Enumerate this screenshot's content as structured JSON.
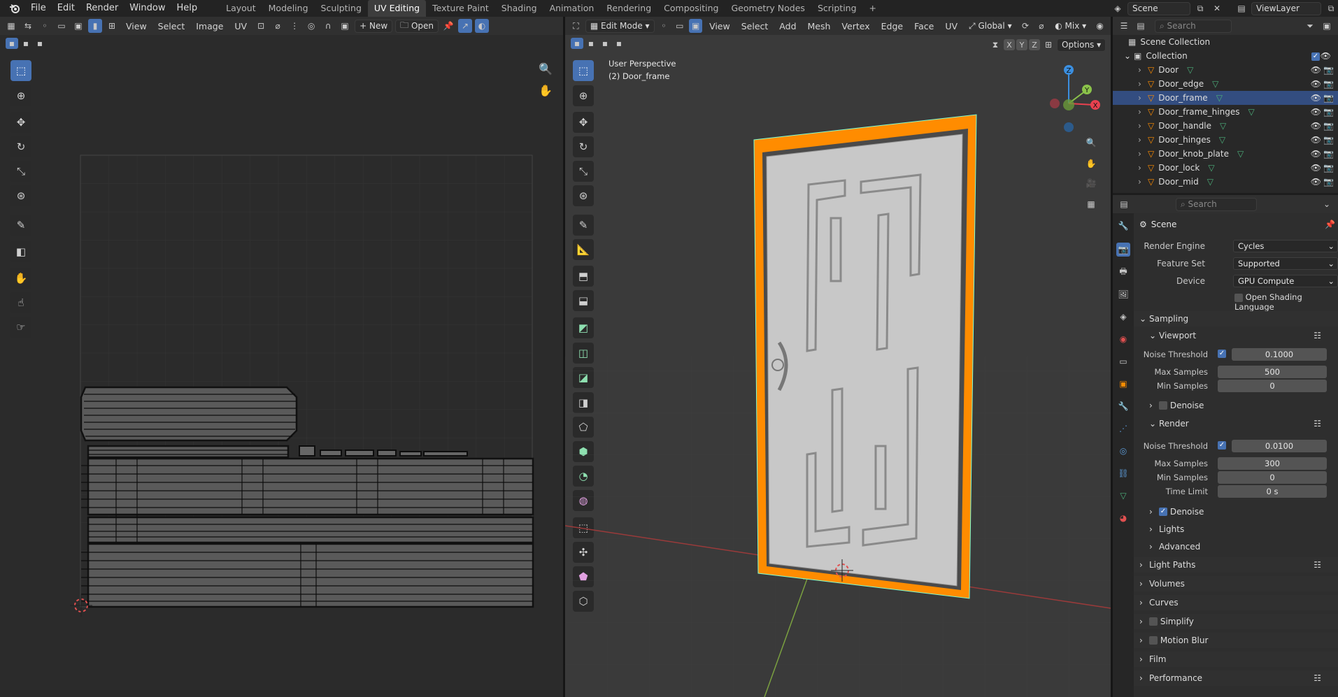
{
  "topbar": {
    "menus": [
      "File",
      "Edit",
      "Render",
      "Window",
      "Help"
    ],
    "workspaces": [
      "Layout",
      "Modeling",
      "Sculpting",
      "UV Editing",
      "Texture Paint",
      "Shading",
      "Animation",
      "Rendering",
      "Compositing",
      "Geometry Nodes",
      "Scripting"
    ],
    "active_workspace": "UV Editing",
    "scene": "Scene",
    "view_layer": "ViewLayer"
  },
  "uv_editor": {
    "menus": [
      "View",
      "Select",
      "Image",
      "UV"
    ],
    "new_label": "New",
    "open_label": "Open"
  },
  "viewport": {
    "mode": "Edit Mode",
    "menus": [
      "View",
      "Select",
      "Add",
      "Mesh",
      "Vertex",
      "Edge",
      "Face",
      "UV"
    ],
    "transform_orientation": "Global",
    "shading_mix": "Mix",
    "options_label": "Options",
    "axes": [
      "X",
      "Y",
      "Z"
    ],
    "perspective_label": "User Perspective",
    "object_label": "(2) Door_frame",
    "gizmo_axes": [
      "Z",
      "Y",
      "X"
    ]
  },
  "outliner": {
    "search_placeholder": "Search",
    "scene_collection": "Scene Collection",
    "collection": "Collection",
    "objects": [
      "Door",
      "Door_edge",
      "Door_frame",
      "Door_frame_hinges",
      "Door_handle",
      "Door_hinges",
      "Door_knob_plate",
      "Door_lock",
      "Door_mid"
    ],
    "selected": "Door_frame"
  },
  "properties": {
    "search_placeholder": "Search",
    "context": "Scene",
    "render_engine_label": "Render Engine",
    "render_engine": "Cycles",
    "feature_set_label": "Feature Set",
    "feature_set": "Supported",
    "device_label": "Device",
    "device": "GPU Compute",
    "osl_label": "Open Shading Language",
    "sampling": "Sampling",
    "viewport": "Viewport",
    "render": "Render",
    "noise_threshold_label": "Noise Threshold",
    "max_samples_label": "Max Samples",
    "min_samples_label": "Min Samples",
    "time_limit_label": "Time Limit",
    "denoise_label": "Denoise",
    "viewport_noise_threshold": "0.1000",
    "viewport_max_samples": "500",
    "viewport_min_samples": "0",
    "render_noise_threshold": "0.0100",
    "render_max_samples": "300",
    "render_min_samples": "0",
    "render_time_limit": "0 s",
    "lights": "Lights",
    "advanced": "Advanced",
    "panels": [
      "Light Paths",
      "Volumes",
      "Curves",
      "Simplify",
      "Motion Blur",
      "Film",
      "Performance"
    ]
  },
  "colors": {
    "accent": "#4772b3",
    "selection_orange": "#ff8c00",
    "outliner_selected": "#334d80",
    "axis_x": "#e8414f",
    "axis_y": "#8bc34a",
    "axis_z": "#3b8fe0"
  }
}
